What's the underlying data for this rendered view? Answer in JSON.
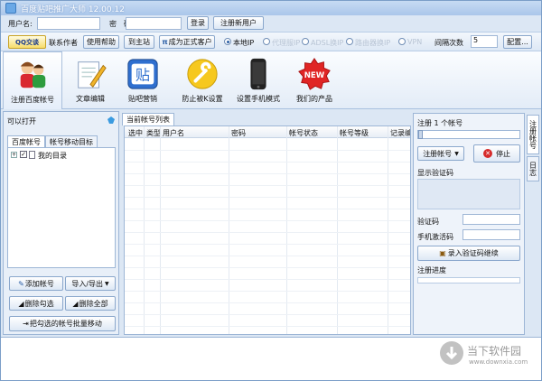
{
  "window": {
    "title": "百度贴吧推广大师 12.00.12"
  },
  "login": {
    "username_label": "用户名:",
    "password_label": "密　码:",
    "login_button": "登录",
    "register_button": "注册新用户"
  },
  "options": {
    "qq_chat": "QQ交谈",
    "contact_author": "联系作者",
    "help": "使用帮助",
    "home": "到主站",
    "become_customer": "成为正式客户",
    "ip_modes": [
      "本地IP",
      "代理服IP",
      "ADSL换IP",
      "路由器换IP",
      "VPN"
    ],
    "redial_label": "间隔次数",
    "redial_value": "5",
    "config_button": "配置..."
  },
  "toolbar": [
    {
      "label": "注册百度帐号",
      "icon": "users-icon"
    },
    {
      "label": "文章编辑",
      "icon": "document-edit-icon"
    },
    {
      "label": "贴吧营销",
      "icon": "tieba-icon"
    },
    {
      "label": "防止被K设置",
      "icon": "wrench-icon"
    },
    {
      "label": "设置手机模式",
      "icon": "mobile-phone-icon"
    },
    {
      "label": "我们的产品",
      "icon": "new-badge-icon"
    }
  ],
  "left_panel": {
    "title": "可以打开",
    "tabs": [
      "百度帐号",
      "帐号移动目标"
    ],
    "tree": {
      "root_label": "我的目录"
    },
    "buttons": {
      "add_account": "添加帐号",
      "import_export": "导入/导出",
      "delete_checked": "删除勾选",
      "delete_all": "删除全部",
      "batch_move": "把勾选的帐号批量移动"
    }
  },
  "grid": {
    "tab": "当前帐号列表",
    "columns": [
      "选中",
      "类型",
      "用户名",
      "密码",
      "帐号状态",
      "帐号等级",
      "记录编"
    ]
  },
  "right_panel": {
    "header": "注册 1 个帐号",
    "register_button": "注册帐号",
    "stop_button": "停止",
    "captcha_display_label": "显示验证码",
    "captcha_label": "验证码",
    "phone_code_label": "手机激活码",
    "submit_captcha_button": "录入验证码继续",
    "progress_label": "注册进度",
    "vertical_tabs": [
      "注册帐号",
      "日志"
    ]
  },
  "watermark": {
    "site": "当下软件园",
    "url": "www.downxia.com"
  },
  "colors": {
    "accent": "#2b5ea5",
    "border": "#9db6d6",
    "stop_red": "#d62b2b"
  }
}
